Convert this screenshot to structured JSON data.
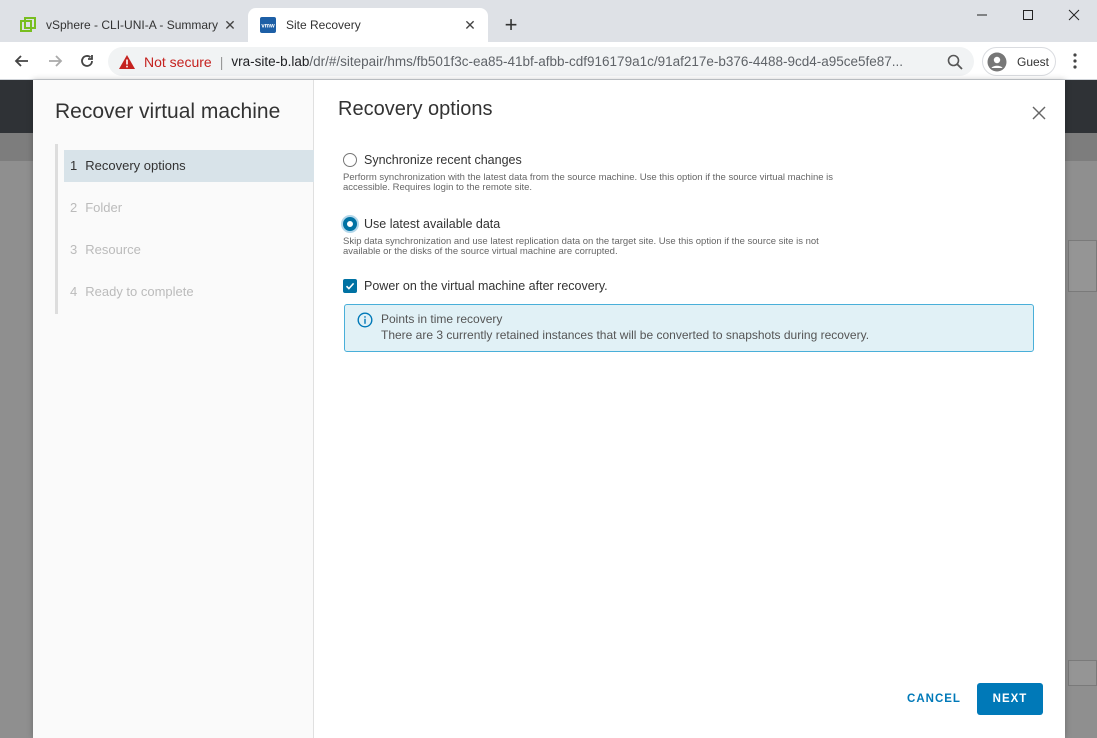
{
  "browser": {
    "tabs": [
      {
        "title": "vSphere - CLI-UNI-A - Summary",
        "icon": "vsphere-icon",
        "active": false
      },
      {
        "title": "Site Recovery",
        "icon": "vmw-icon",
        "active": true
      }
    ],
    "security_label": "Not secure",
    "url_host": "vra-site-b.lab",
    "url_path": "/dr/#/sitepair/hms/fb501f3c-ea85-41bf-afbb-cdf916179a1c/91af217e-b376-4488-9cd4-a95ce5fe87...",
    "profile_label": "Guest",
    "favicon_text": "vmw"
  },
  "modal": {
    "wizard_title": "Recover virtual machine",
    "steps": [
      {
        "num": "1",
        "label": "Recovery options",
        "active": true
      },
      {
        "num": "2",
        "label": "Folder",
        "active": false
      },
      {
        "num": "3",
        "label": "Resource",
        "active": false
      },
      {
        "num": "4",
        "label": "Ready to complete",
        "active": false
      }
    ],
    "page_title": "Recovery options",
    "options": [
      {
        "label": "Synchronize recent changes",
        "selected": false,
        "desc_line1": "Perform synchronization with the latest data from the source machine. Use this option if the source virtual machine is",
        "desc_line2": "accessible. Requires login to the remote site."
      },
      {
        "label": "Use latest available data",
        "selected": true,
        "desc_line1": "Skip data synchronization and use latest replication data on the target site. Use this option if the source site is not",
        "desc_line2": "available or the disks of the source virtual machine are corrupted."
      }
    ],
    "power_on_label": "Power on the virtual machine after recovery.",
    "power_on_checked": true,
    "alert_title": "Points in time recovery",
    "alert_text": "There are 3 currently retained instances that will be converted to snapshots during recovery.",
    "cancel_label": "CANCEL",
    "next_label": "NEXT"
  },
  "colors": {
    "accent": "#0079b8",
    "alert_bg": "#e1f1f6",
    "alert_border": "#49afd9",
    "not_secure": "#c5221f"
  }
}
